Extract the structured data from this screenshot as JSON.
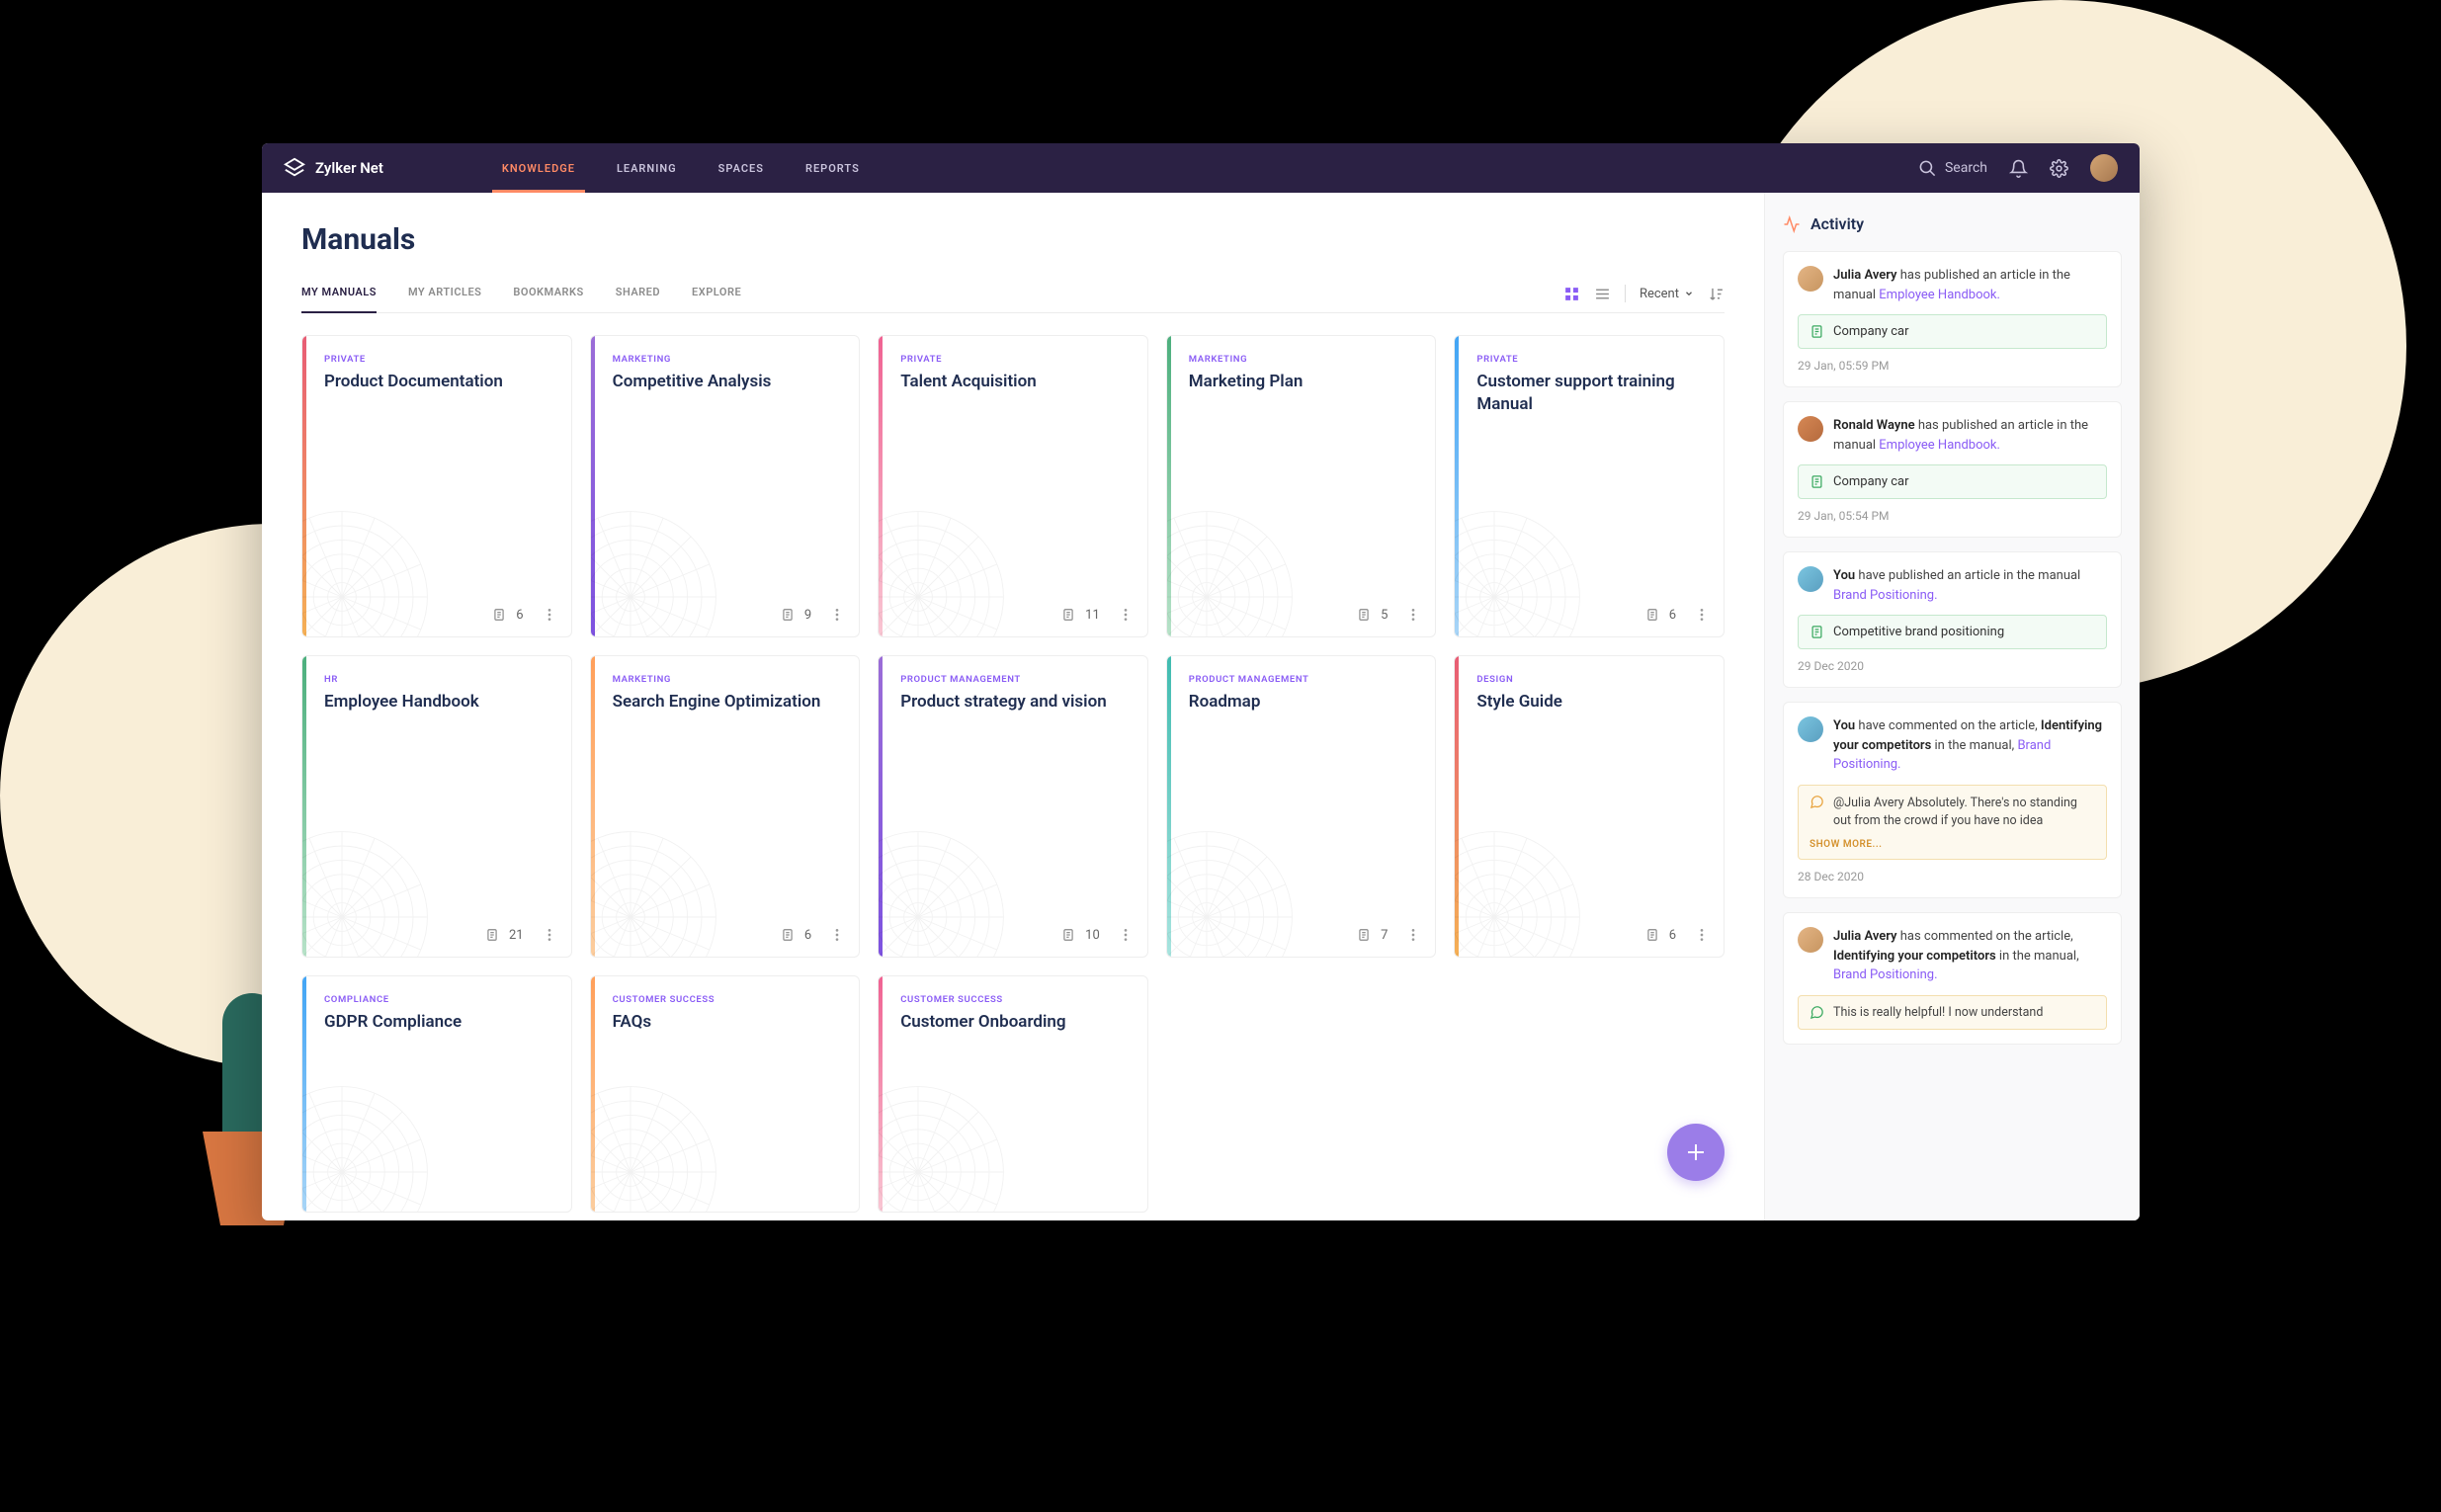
{
  "brand": "Zylker Net",
  "nav": [
    "KNOWLEDGE",
    "LEARNING",
    "SPACES",
    "REPORTS"
  ],
  "nav_active": 0,
  "search_placeholder": "Search",
  "page_title": "Manuals",
  "subtabs": [
    "MY MANUALS",
    "MY ARTICLES",
    "BOOKMARKS",
    "SHARED",
    "EXPLORE"
  ],
  "subtab_active": 0,
  "sort_label": "Recent",
  "cards": [
    {
      "cat": "PRIVATE",
      "title": "Product Documentation",
      "count": 6,
      "color": "c-red"
    },
    {
      "cat": "MARKETING",
      "title": "Competitive Analysis",
      "count": 9,
      "color": "c-purple"
    },
    {
      "cat": "PRIVATE",
      "title": "Talent Acquisition",
      "count": 11,
      "color": "c-pink"
    },
    {
      "cat": "MARKETING",
      "title": "Marketing Plan",
      "count": 5,
      "color": "c-green"
    },
    {
      "cat": "PRIVATE",
      "title": "Customer support training Manual",
      "count": 6,
      "color": "c-blue"
    },
    {
      "cat": "HR",
      "title": "Employee Handbook",
      "count": 21,
      "color": "c-green"
    },
    {
      "cat": "MARKETING",
      "title": "Search Engine Optimization",
      "count": 6,
      "color": "c-orange"
    },
    {
      "cat": "PRODUCT MANAGEMENT",
      "title": "Product strategy and vision",
      "count": 10,
      "color": "c-purple"
    },
    {
      "cat": "PRODUCT MANAGEMENT",
      "title": "Roadmap",
      "count": 7,
      "color": "c-teal"
    },
    {
      "cat": "DESIGN",
      "title": "Style Guide",
      "count": 6,
      "color": "c-red"
    },
    {
      "cat": "COMPLIANCE",
      "title": "GDPR Compliance",
      "count": null,
      "color": "c-blue",
      "short": true
    },
    {
      "cat": "CUSTOMER SUCCESS",
      "title": "FAQs",
      "count": null,
      "color": "c-orange",
      "short": true
    },
    {
      "cat": "CUSTOMER SUCCESS",
      "title": "Customer Onboarding",
      "count": null,
      "color": "c-pink",
      "short": true
    }
  ],
  "activity_title": "Activity",
  "activity": [
    {
      "av": "av0",
      "line": [
        {
          "b": "Julia Avery"
        },
        {
          "t": " has published an article in the manual "
        },
        {
          "lk": "Employee Handbook."
        }
      ],
      "box_type": "doc",
      "box_text": "Company car",
      "time": "29 Jan, 05:59 PM"
    },
    {
      "av": "av1",
      "line": [
        {
          "b": "Ronald Wayne"
        },
        {
          "t": " has published an article in the manual "
        },
        {
          "lk": "Employee Handbook."
        }
      ],
      "box_type": "doc",
      "box_text": "Company car",
      "time": "29 Jan, 05:54 PM"
    },
    {
      "av": "av2",
      "line": [
        {
          "b": "You"
        },
        {
          "t": " have published an article in the manual "
        },
        {
          "lk": "Brand Positioning."
        }
      ],
      "box_type": "doc",
      "box_text": "Competitive brand positioning",
      "time": "29 Dec 2020"
    },
    {
      "av": "av2",
      "line": [
        {
          "b": "You"
        },
        {
          "t": " have commented on the article, "
        },
        {
          "b": "Identifying your competitors"
        },
        {
          "t": " in the manual, "
        },
        {
          "lk": "Brand Positioning."
        }
      ],
      "box_type": "comment",
      "mention": "@Julia Avery",
      "comment": " Absolutely. There's no standing out from the crowd if you have no idea",
      "showmore": "SHOW MORE...",
      "time": "28 Dec 2020"
    },
    {
      "av": "av0",
      "line": [
        {
          "b": "Julia Avery"
        },
        {
          "t": " has commented on the article, "
        },
        {
          "b": "Identifying your competitors"
        },
        {
          "t": " in the manual, "
        },
        {
          "lk": "Brand Positioning."
        }
      ],
      "box_type": "comment_partial",
      "comment": "This is really helpful! I now understand"
    }
  ]
}
